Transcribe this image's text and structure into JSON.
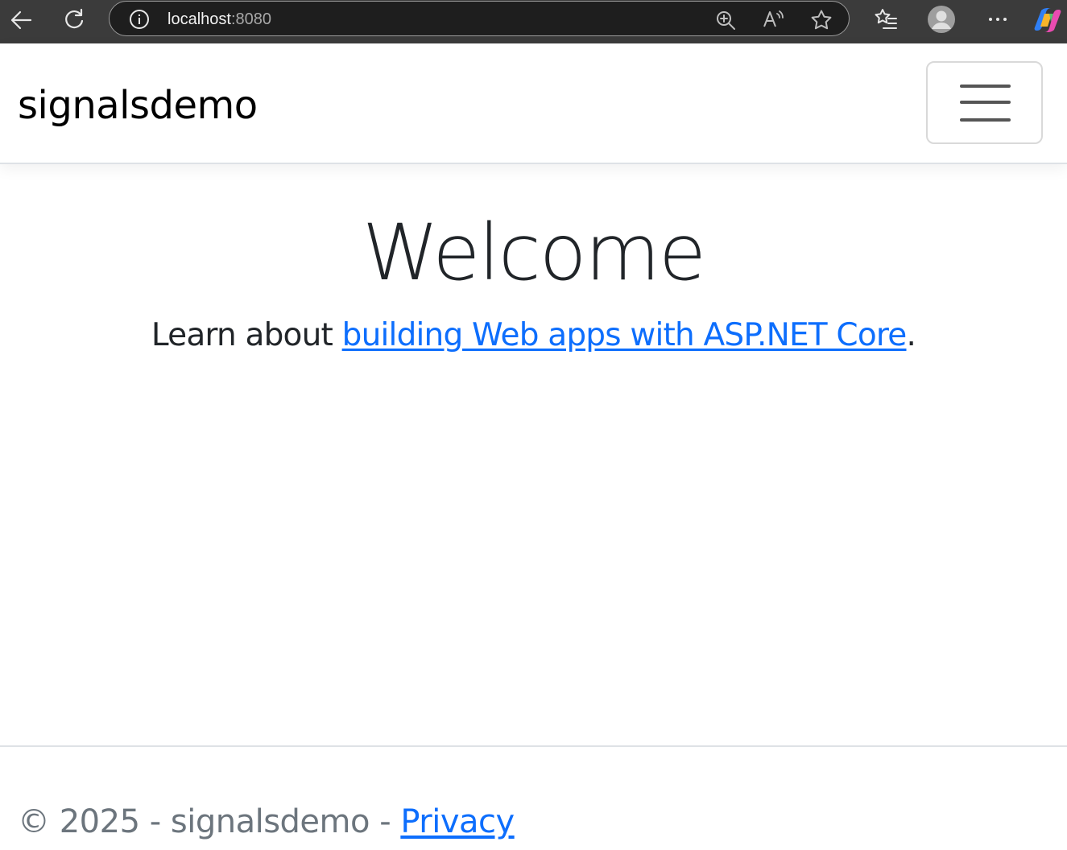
{
  "browser": {
    "url_host": "localhost",
    "url_port": ":8080",
    "icons": [
      "back-icon",
      "refresh-icon",
      "info-icon",
      "zoom-icon",
      "read-aloud-icon",
      "favorite-star-icon",
      "favorites-icon",
      "profile-avatar-icon",
      "more-icon",
      "copilot-icon"
    ]
  },
  "navbar": {
    "brand": "signalsdemo",
    "toggler_icon": "hamburger-menu-icon"
  },
  "main": {
    "heading": "Welcome",
    "lead_prefix": "Learn about ",
    "lead_link": "building Web apps with ASP.NET Core",
    "lead_suffix": "."
  },
  "footer": {
    "copyright": "© 2025 - signalsdemo - ",
    "privacy_link": "Privacy"
  },
  "colors": {
    "chrome_bg": "#3b3b3b",
    "address_bg": "#1e1e1e",
    "link": "#0d6efd",
    "text": "#212529",
    "muted": "#6c757d",
    "border": "#dee2e6"
  }
}
